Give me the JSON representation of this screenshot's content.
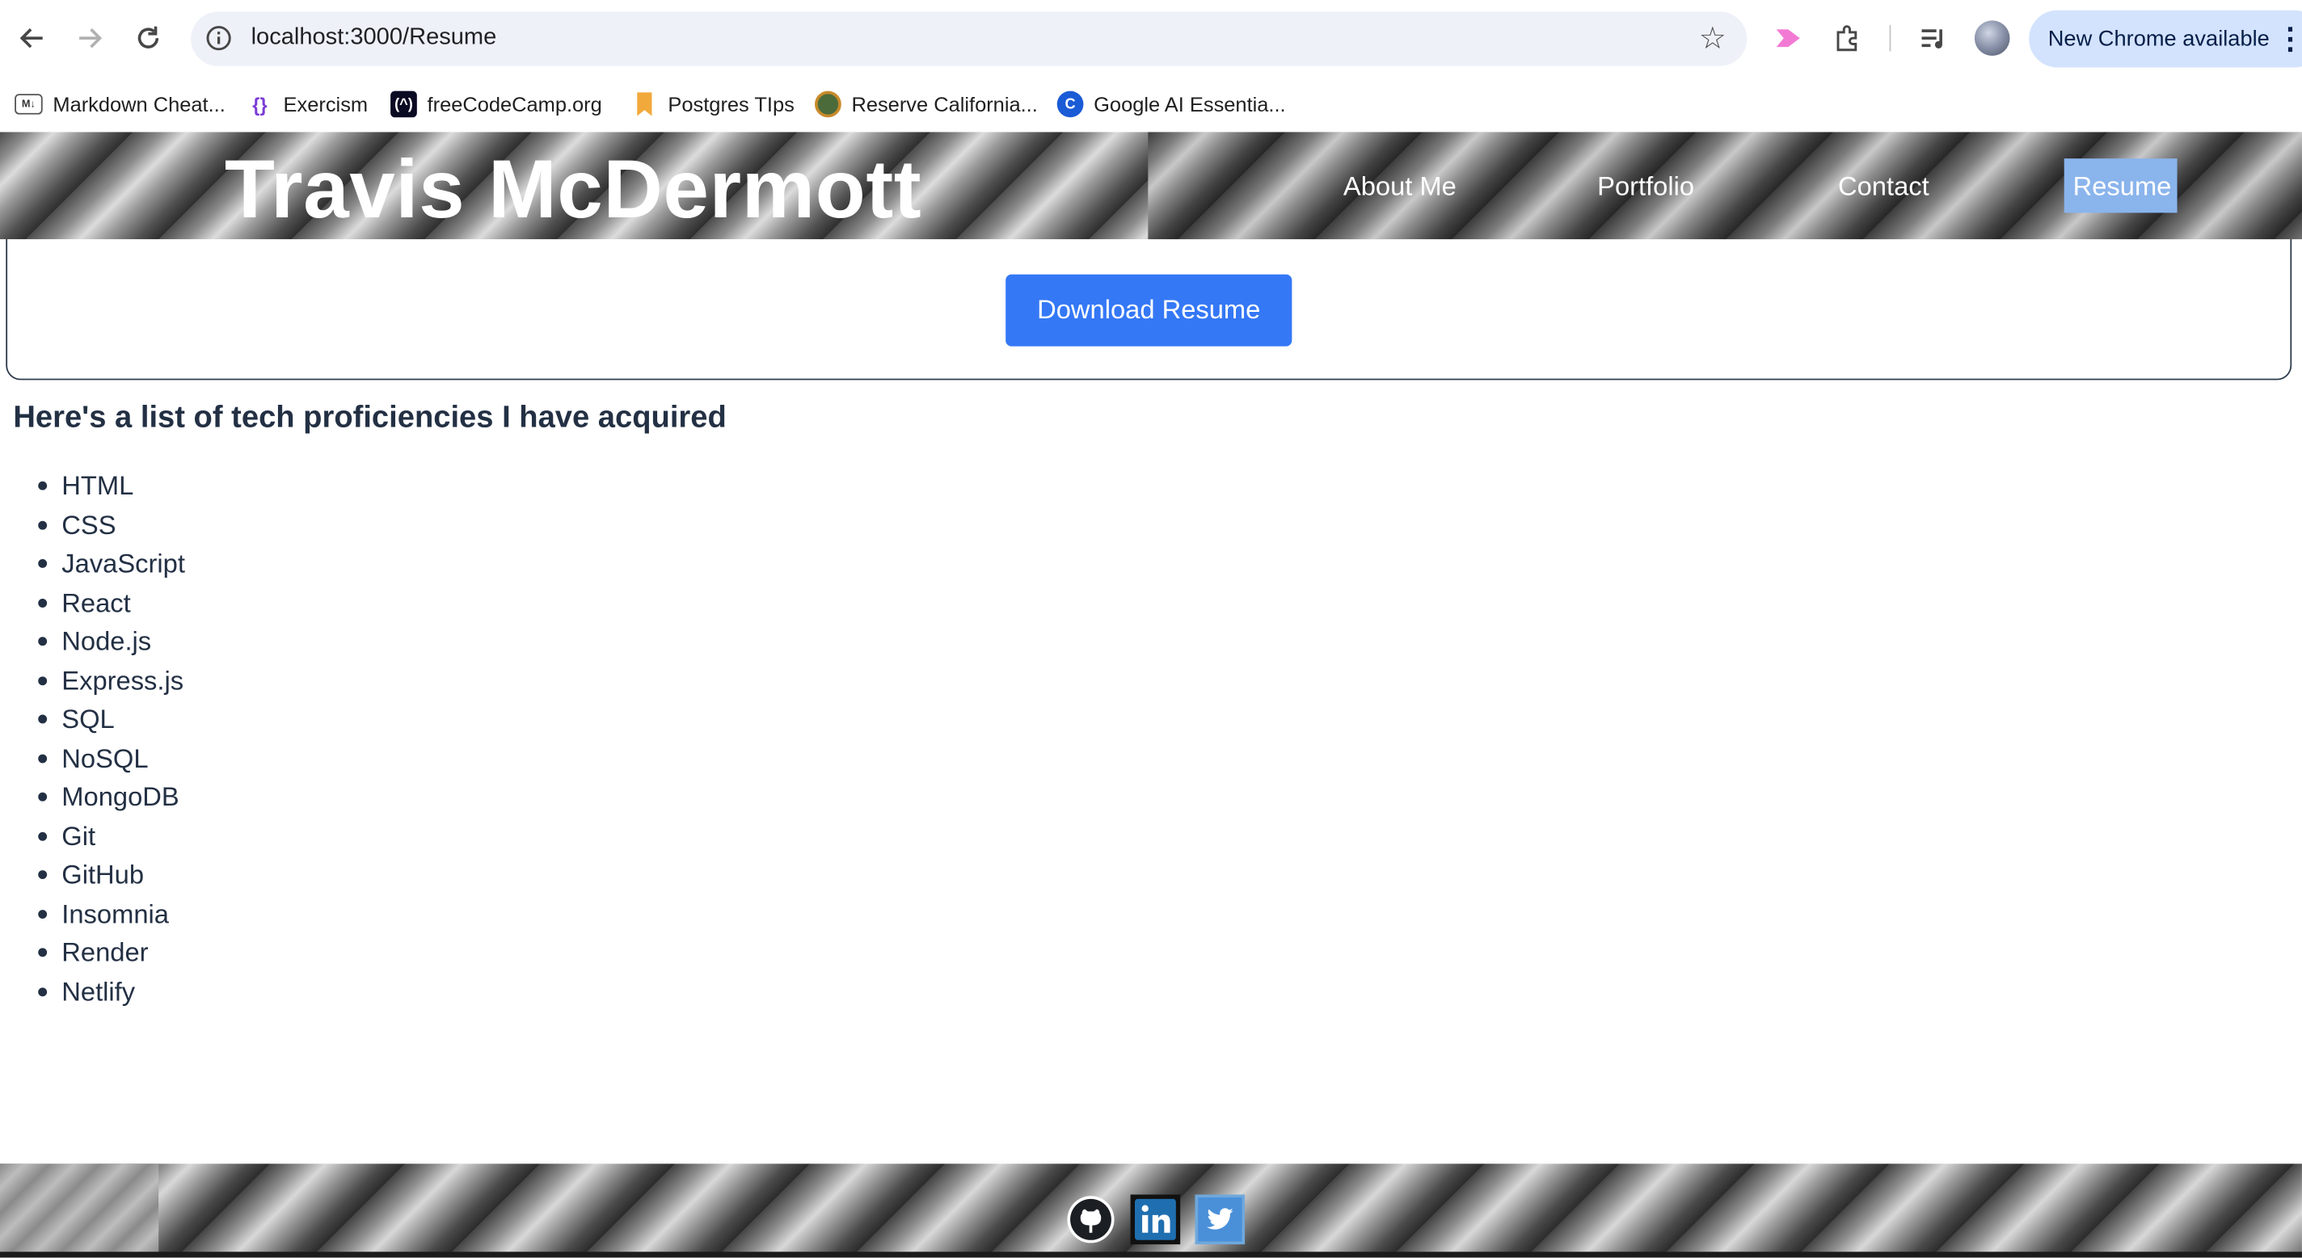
{
  "browser": {
    "url": "localhost:3000/Resume",
    "update_chip": "New Chrome available",
    "bookmarks": [
      {
        "label": "Markdown Cheat...",
        "icon": "markdown-icon"
      },
      {
        "label": "Exercism",
        "icon": "exercism-icon"
      },
      {
        "label": "freeCodeCamp.org",
        "icon": "freecodecamp-icon"
      },
      {
        "label": "Postgres TIps",
        "icon": "bookmark-icon"
      },
      {
        "label": "Reserve California...",
        "icon": "reserve-california-icon"
      },
      {
        "label": "Google AI Essentia...",
        "icon": "google-ai-icon"
      }
    ]
  },
  "header": {
    "name": "Travis McDermott",
    "nav": [
      {
        "label": "About Me"
      },
      {
        "label": "Portfolio"
      },
      {
        "label": "Contact"
      },
      {
        "label": "Resume",
        "active": true
      }
    ]
  },
  "resume": {
    "download_label": "Download Resume",
    "proficiencies_heading": "Here's a list of tech proficiencies I have acquired",
    "proficiencies": [
      "HTML",
      "CSS",
      "JavaScript",
      "React",
      "Node.js",
      "Express.js",
      "SQL",
      "NoSQL",
      "MongoDB",
      "Git",
      "GitHub",
      "Insomnia",
      "Render",
      "Netlify"
    ]
  },
  "footer": {
    "social": [
      {
        "icon": "github-icon"
      },
      {
        "icon": "linkedin-icon"
      },
      {
        "icon": "twitter-icon"
      }
    ]
  },
  "colors": {
    "primary_button": "#3478f6",
    "active_nav": "#8ab4ec",
    "text": "#233044"
  }
}
